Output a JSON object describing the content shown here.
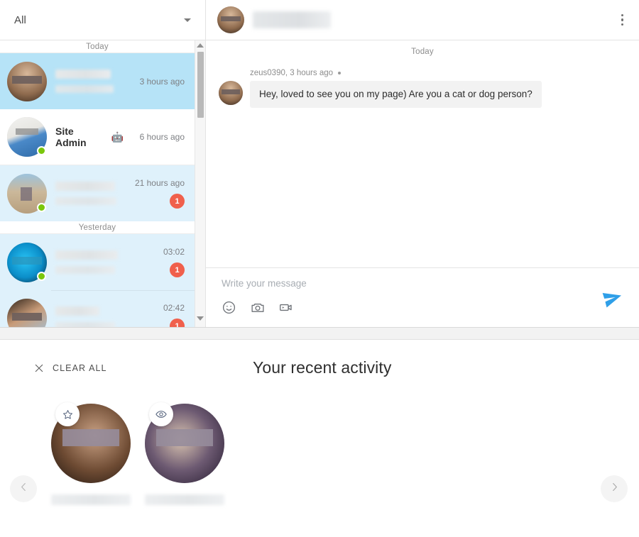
{
  "messenger": {
    "filter": {
      "label": "All",
      "caret_icon": "chevron-down-icon"
    },
    "day_separators": {
      "today": "Today",
      "yesterday": "Yesterday"
    },
    "conversations": [
      {
        "name": "",
        "name_blurred": true,
        "time": "3 hours ago",
        "unread": "",
        "state": "selected",
        "online": false
      },
      {
        "name": "Site Admin",
        "name_blurred": false,
        "bot_icon": "robot-emoji",
        "time": "6 hours ago",
        "unread": "",
        "state": "plain",
        "online": true
      },
      {
        "name": "",
        "name_blurred": true,
        "time": "21 hours ago",
        "unread": "1",
        "state": "unread",
        "online": true
      },
      {
        "name": "",
        "name_blurred": true,
        "time": "03:02",
        "unread": "1",
        "state": "unread",
        "online": true
      },
      {
        "name": "",
        "name_blurred": true,
        "time": "02:42",
        "unread": "1",
        "state": "unread",
        "online": true
      }
    ],
    "scrollbar": {
      "up_icon": "scroll-up-arrow",
      "down_icon": "scroll-down-arrow"
    }
  },
  "chat": {
    "header": {
      "name": "",
      "name_blurred": true,
      "menu_icon": "kebab-menu-icon"
    },
    "day_label": "Today",
    "messages": [
      {
        "author": "zeus0390",
        "timestamp": "3 hours ago",
        "meta": "zeus0390, 3 hours ago",
        "text": "Hey, loved to see you on my page) Are you a cat or dog person?"
      }
    ],
    "composer": {
      "placeholder": "Write your message",
      "value": "",
      "tools": [
        {
          "icon": "emoji-smiley-icon",
          "name": "emoji-button"
        },
        {
          "icon": "camera-icon",
          "name": "photo-button"
        },
        {
          "icon": "video-camera-icon",
          "name": "video-button"
        }
      ],
      "send_icon": "send-arrow-icon",
      "send_color": "#2f9fe8"
    }
  },
  "activity": {
    "clear_all_label": "CLEAR ALL",
    "clear_all_icon": "close-x-icon",
    "title": "Your recent activity",
    "prev_icon": "chevron-left-icon",
    "next_icon": "chevron-right-icon",
    "cards": [
      {
        "badge_icon": "star-icon",
        "name": "",
        "name_blurred": true
      },
      {
        "badge_icon": "eye-icon",
        "name": "",
        "name_blurred": true
      }
    ]
  },
  "colors": {
    "selected_row": "#b6e3f7",
    "unread_row": "#dff1fb",
    "unread_badge": "#f0604c",
    "online_dot": "#7ac70c",
    "send_blue": "#2f9fe8",
    "page_bg": "#f2f2f2"
  }
}
